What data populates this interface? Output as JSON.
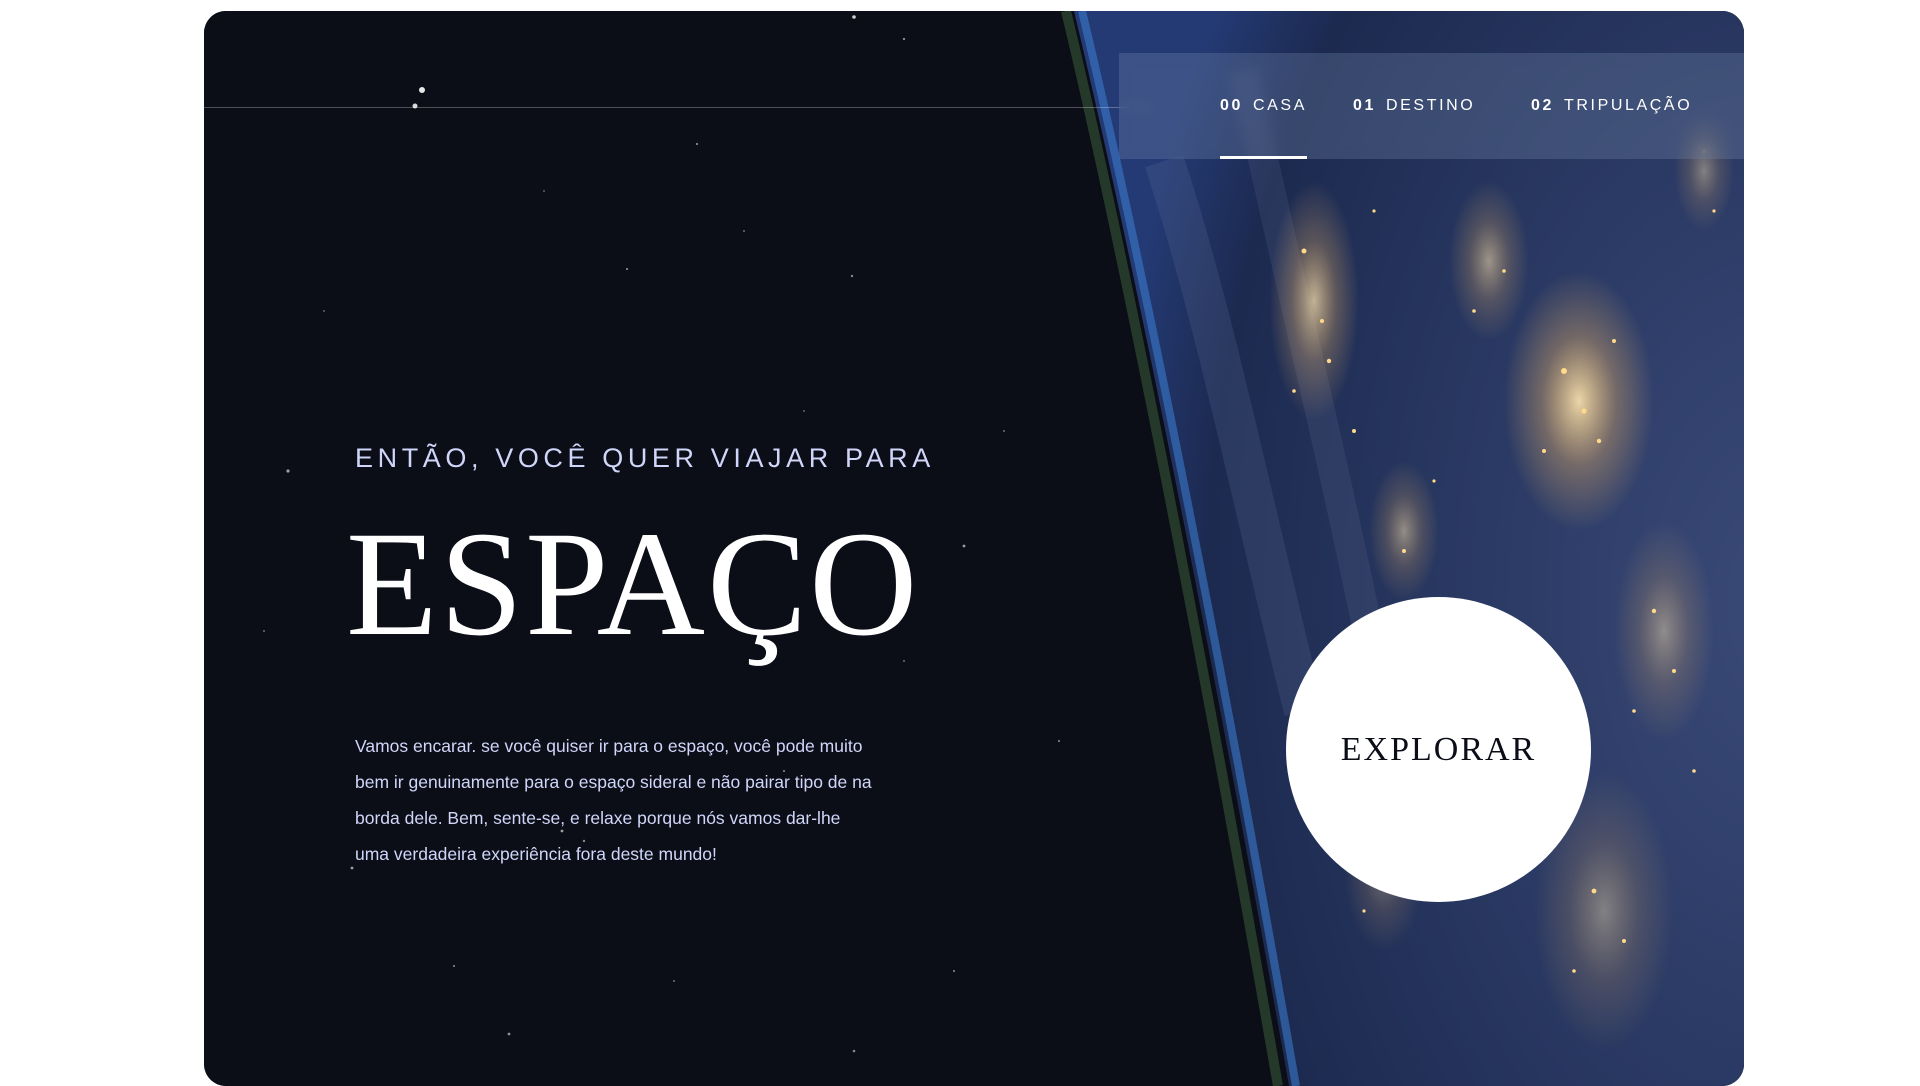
{
  "nav": {
    "items": [
      {
        "num": "00",
        "label": "CASA",
        "active": true
      },
      {
        "num": "01",
        "label": "DESTINO",
        "active": false
      },
      {
        "num": "02",
        "label": "TRIPULAÇÃO",
        "active": false
      }
    ]
  },
  "hero": {
    "kicker": "ENTÃO, VOCÊ QUER VIAJAR PARA",
    "title": "ESPAÇO",
    "text": "Vamos encarar. se você quiser ir para o espaço, você pode muito bem ir genuinamente para o espaço sideral e não pairar tipo de na borda dele. Bem, sente-se, e relaxe porque nós vamos dar-lhe uma verdadeira experiência fora deste mundo!",
    "explore_label": "EXPLORAR"
  },
  "colors": {
    "background": "#0b0d17",
    "accent_text": "#d0d6f9",
    "white": "#ffffff"
  }
}
